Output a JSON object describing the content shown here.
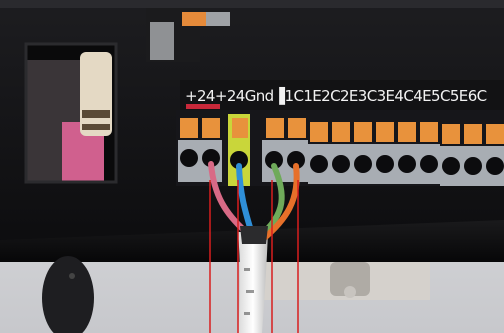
{
  "photo": {
    "subject": "terminal-block-wiring-closeup",
    "terminal_strip_label": "+24+24Gnd▐1C1E2C2E3C3E4C4E5C5E6C",
    "wire_colors": {
      "pink": "#d86a86",
      "blue": "#2f8fd8",
      "green": "#6faa5a",
      "orange": "#e6702a",
      "callout_lines": "#d81e1e",
      "terminal_orange": "#e8923c",
      "terminal_gray": "#a8adb3",
      "terminal_yellow": "#c9d63a",
      "housing": "#141416"
    }
  }
}
